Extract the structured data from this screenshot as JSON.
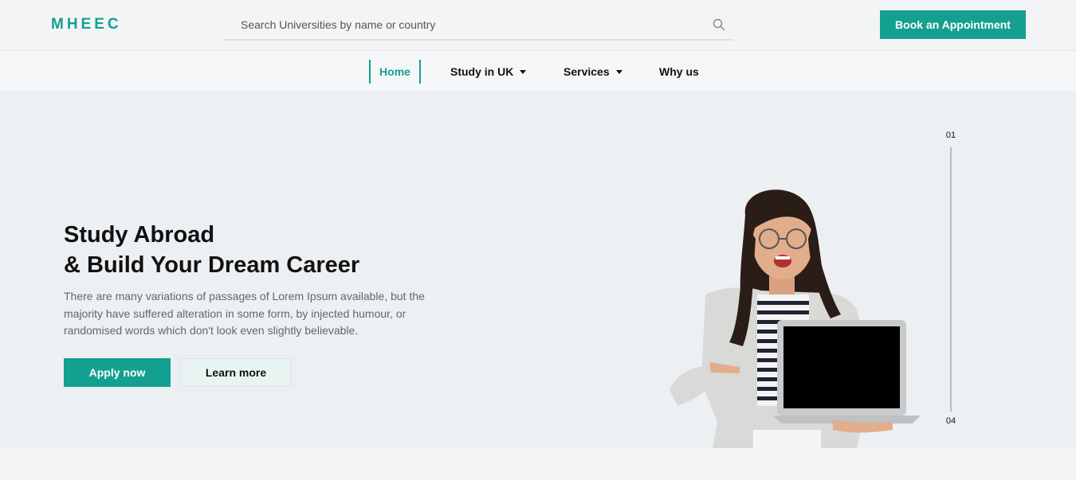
{
  "header": {
    "logo": "MHEEC",
    "search": {
      "placeholder": "Search Universities by name or country",
      "value": ""
    },
    "book_button": "Book an Appointment"
  },
  "nav": {
    "items": [
      {
        "label": "Home",
        "active": true
      },
      {
        "label": "Study in UK",
        "dropdown": true
      },
      {
        "label": "Services",
        "dropdown": true
      },
      {
        "label": "Why us"
      }
    ]
  },
  "hero": {
    "title_line1": "Study Abroad",
    "title_line2": "& Build Your Dream Career",
    "description": "There are many variations of passages of Lorem Ipsum available, but the majority have suffered alteration in some form, by injected humour, or randomised words which don't look even slightly believable.",
    "apply_button": "Apply now",
    "learn_button": "Learn more",
    "slider": {
      "first": "01",
      "last": "04"
    }
  },
  "colors": {
    "accent": "#13a090",
    "hero_bg": "#edf0f2",
    "page_bg": "#f3f4f6"
  },
  "icons": {
    "search": "search-icon",
    "caret": "caret-down-icon"
  }
}
